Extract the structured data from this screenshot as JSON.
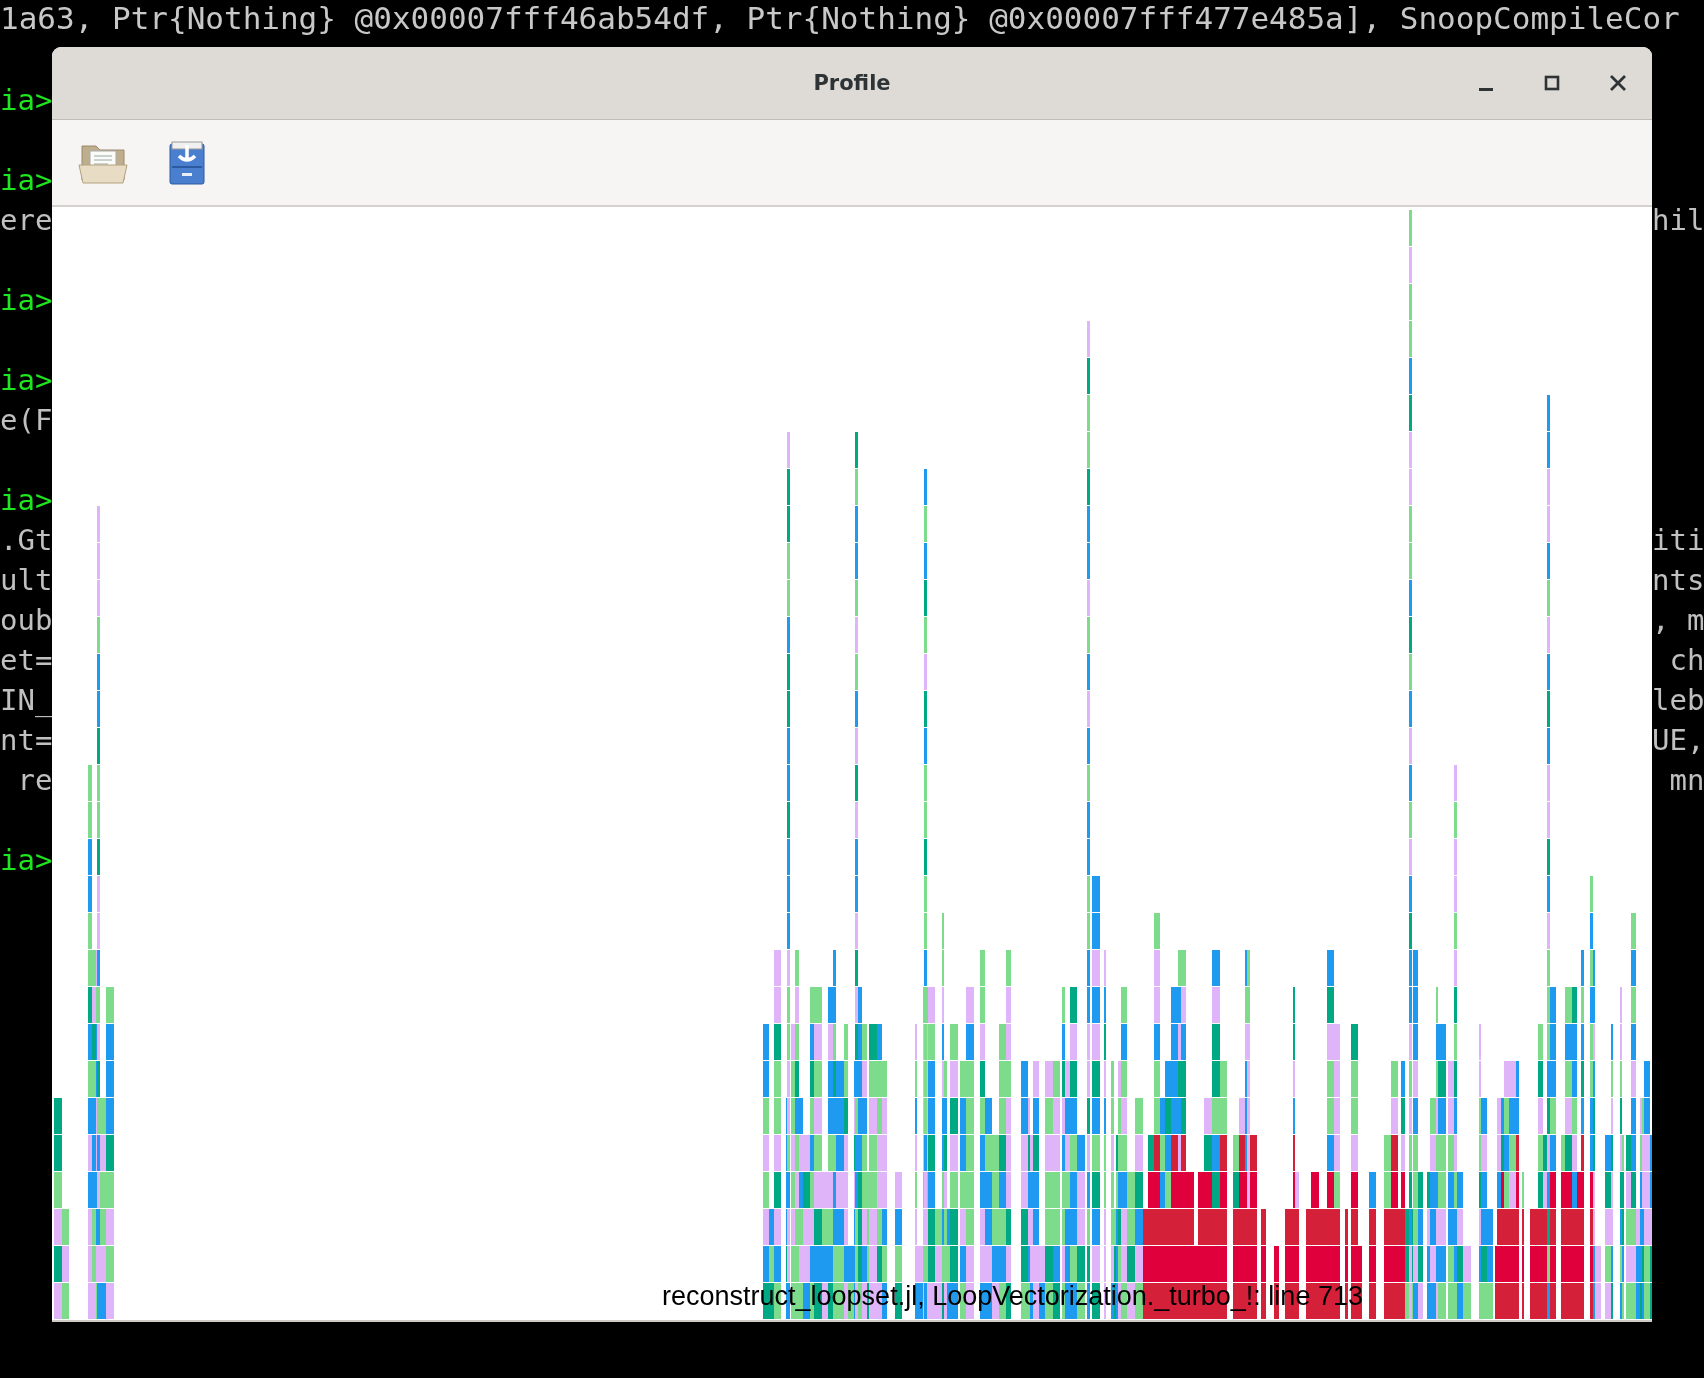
{
  "terminal": {
    "top_line": "1a63, Ptr{Nothing} @0x00007fff46ab54df, Ptr{Nothing} @0x00007fff477e485a], SnoopCompileCor",
    "rows": [
      {},
      {
        "kind": "prompt",
        "left": "ia>"
      },
      {},
      {
        "kind": "prompt",
        "left": "ia>"
      },
      {
        "kind": "output",
        "left": "ere",
        "right": "hil"
      },
      {},
      {
        "kind": "prompt",
        "left": "ia>"
      },
      {},
      {
        "kind": "prompt",
        "left": "ia>"
      },
      {
        "kind": "output",
        "left": "e(F"
      },
      {},
      {
        "kind": "prompt",
        "left": "ia>"
      },
      {
        "kind": "output",
        "left": ".Gt",
        "right": "iti"
      },
      {
        "kind": "output",
        "left": "ult",
        "right": "nts"
      },
      {
        "kind": "output",
        "left": "oub",
        "right": ", m"
      },
      {
        "kind": "output",
        "left": "et=",
        "right": " ch"
      },
      {
        "kind": "output",
        "left": "IN_",
        "right": "leb"
      },
      {
        "kind": "output",
        "left": "nt=",
        "right": "UE,"
      },
      {
        "kind": "output",
        "left": " re",
        "right": " mn"
      },
      {},
      {
        "kind": "prompt",
        "left": "ia>"
      }
    ]
  },
  "window": {
    "title": "Profile",
    "hover_label": "reconstruct_loopset.jl, LoopVectorization._turbo_!: line 713"
  }
}
